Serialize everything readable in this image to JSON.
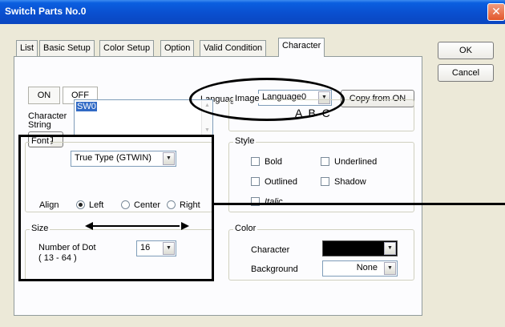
{
  "window": {
    "title": "Switch Parts No.0"
  },
  "tabs": [
    "List",
    "Basic Setup",
    "Color Setup",
    "Option",
    "Valid Condition",
    "Character"
  ],
  "side_buttons": {
    "ok": "OK",
    "cancel": "Cancel"
  },
  "state_buttons": {
    "on": "ON",
    "off": "OFF"
  },
  "language": {
    "label": "Language",
    "value": "Language0",
    "copy_button": "Copy from ON"
  },
  "character_string": {
    "label_line1": "Character",
    "label_line2": "String",
    "value": "SW0",
    "eng_button": "Eng"
  },
  "image": {
    "label": "Image",
    "preview": "A B C"
  },
  "font": {
    "group_title": "Font",
    "type_value": "True Type (GTWIN)",
    "align_label": "Align",
    "align_options": [
      "Left",
      "Center",
      "Right"
    ],
    "align_selected": "Left"
  },
  "size": {
    "group_title": "Size",
    "dot_label": "Number of Dot",
    "dot_range": "( 13 - 64 )",
    "dot_value": "16"
  },
  "style": {
    "group_title": "Style",
    "options": [
      "Bold",
      "Underlined",
      "Outlined",
      "Shadow",
      "Italic"
    ]
  },
  "color": {
    "group_title": "Color",
    "character_label": "Character",
    "character_color": "#000000",
    "background_label": "Background",
    "background_value": "None"
  }
}
